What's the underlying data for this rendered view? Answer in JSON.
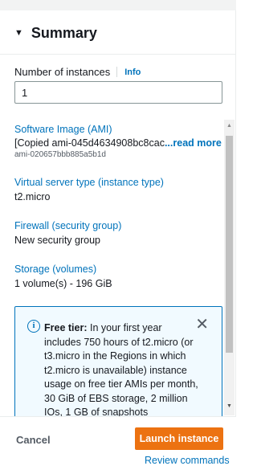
{
  "summary": {
    "title": "Summary",
    "instances_label": "Number of instances",
    "info_link": "Info",
    "instances_value": "1"
  },
  "sections": {
    "ami": {
      "title": "Software Image (AMI)",
      "value": "[Copied ami-045d4634908bc8cac ",
      "read_more": "...read more",
      "id": "ami-020657bbb885a5b1d"
    },
    "instance_type": {
      "title": "Virtual server type (instance type)",
      "value": "t2.micro"
    },
    "firewall": {
      "title": "Firewall (security group)",
      "value": "New security group"
    },
    "storage": {
      "title": "Storage (volumes)",
      "value": "1 volume(s) - 196 GiB"
    }
  },
  "free_tier": {
    "heading": "Free tier:",
    "body": " In your first year includes 750 hours of t2.micro (or t3.micro in the Regions in which t2.micro is unavailable) instance usage on free tier AMIs per month, 30 GiB of EBS storage, 2 million IOs, 1 GB of snapshots"
  },
  "footer": {
    "cancel": "Cancel",
    "launch": "Launch instance",
    "review": "Review commands"
  },
  "colors": {
    "link": "#0073bb",
    "primary_button": "#ec7211",
    "info_box_bg": "#f1faff"
  },
  "icons": {
    "caret": "caret-down-icon",
    "info": "info-circle-icon",
    "close": "close-icon"
  }
}
